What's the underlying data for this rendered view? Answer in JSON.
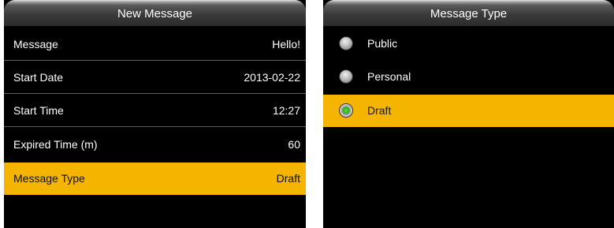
{
  "left_screen": {
    "title": "New Message",
    "rows": [
      {
        "label": "Message",
        "value": "Hello!"
      },
      {
        "label": "Start Date",
        "value": "2013-02-22"
      },
      {
        "label": "Start Time",
        "value": "12:27"
      },
      {
        "label": "Expired Time (m)",
        "value": "60"
      },
      {
        "label": "Message Type",
        "value": "Draft",
        "selected": true
      }
    ]
  },
  "right_screen": {
    "title": "Message Type",
    "options": [
      {
        "label": "Public",
        "checked": false
      },
      {
        "label": "Personal",
        "checked": false
      },
      {
        "label": "Draft",
        "checked": true,
        "selected": true
      }
    ]
  },
  "colors": {
    "highlight": "#f5b400",
    "background": "#000000",
    "radio_checked": "#3ccc28"
  }
}
